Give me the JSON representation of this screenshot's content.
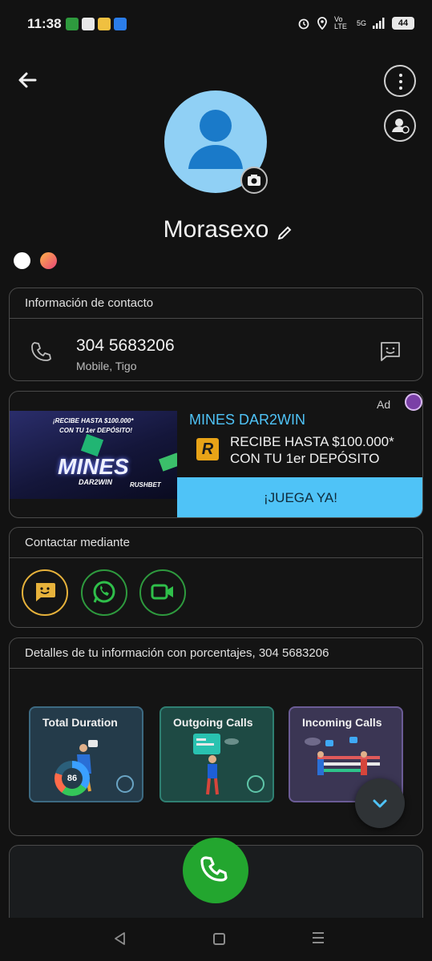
{
  "status_bar": {
    "time": "11:38",
    "network": "5G",
    "volte": "Vo LTE",
    "battery": "44"
  },
  "contact": {
    "name": "Morasexo",
    "info_header": "Información de contacto",
    "phone_number": "304 5683206",
    "phone_sub": "Mobile, Tigo"
  },
  "ad": {
    "label": "Ad",
    "image_line1": "¡RECIBE HASTA $100.000*",
    "image_line2": "CON TU 1er DEPÓSITO!",
    "image_brand": "MINES",
    "image_sub": "DAR2WIN",
    "image_sponsor": "RUSHBET",
    "title": "MINES DAR2WIN",
    "logo_letter": "R",
    "body": "RECIBE HASTA $100.000* CON TU 1er DEPÓSITO",
    "cta": "¡JUEGA YA!"
  },
  "contact_via": {
    "header": "Contactar mediante"
  },
  "details": {
    "header": "Detalles de tu información con porcentajes, 304 5683206",
    "tiles": [
      {
        "label": "Total Duration",
        "value": "86"
      },
      {
        "label": "Outgoing Calls"
      },
      {
        "label": "Incoming Calls"
      }
    ]
  },
  "colors": {
    "accent_blue": "#4fc3f7",
    "call_green": "#23a62f",
    "sms_yellow": "#e7b23b",
    "avatar_blue": "#90d0f5"
  },
  "icons": [
    "back-arrow-icon",
    "more-vert-icon",
    "profile-icon",
    "camera-icon",
    "pencil-icon",
    "phone-icon",
    "message-icon",
    "whatsapp-icon",
    "meet-icon",
    "chevron-down-icon",
    "call-icon"
  ]
}
